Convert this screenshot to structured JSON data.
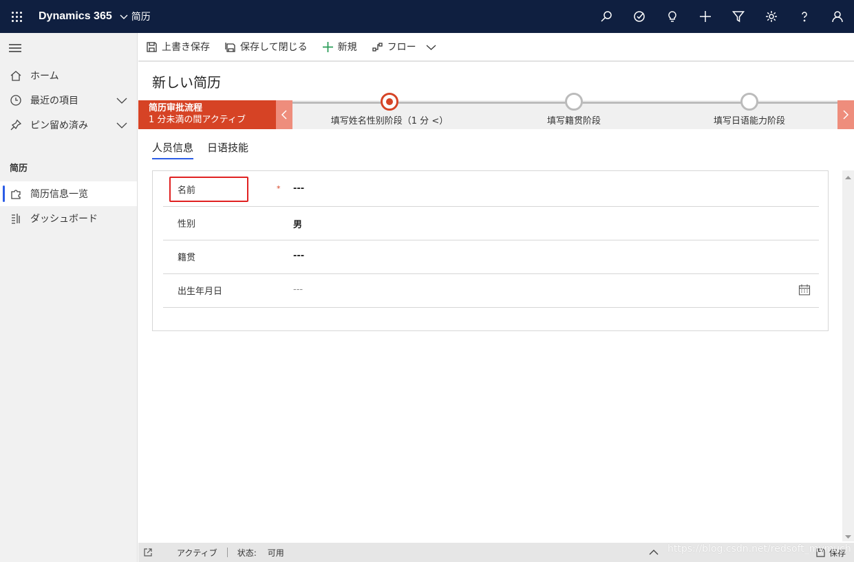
{
  "topbar": {
    "app_name": "Dynamics 365",
    "module_name": "简历",
    "icons": [
      "search-icon",
      "assistant-icon",
      "lightbulb-icon",
      "plus-icon",
      "filter-icon",
      "gear-icon",
      "help-icon",
      "user-icon"
    ]
  },
  "sidebar": {
    "items": [
      {
        "label": "ホーム",
        "icon": "home-icon"
      },
      {
        "label": "最近の項目",
        "icon": "clock-icon"
      },
      {
        "label": "ピン留め済み",
        "icon": "pin-icon"
      }
    ],
    "group_title": "简历",
    "group_items": [
      {
        "label": "简历信息一览",
        "icon": "puzzle-icon"
      },
      {
        "label": "ダッシュボード",
        "icon": "dashboard-icon"
      }
    ]
  },
  "commandbar": {
    "save": "上書き保存",
    "save_close": "保存して閉じる",
    "new": "新規",
    "flow": "フロー"
  },
  "form": {
    "title": "新しい简历"
  },
  "bpf": {
    "title": "简历审批流程",
    "subtitle": "1 分未満の間アクティブ",
    "stages": [
      {
        "label": "填写姓名性别阶段（1 分 <）",
        "active": true
      },
      {
        "label": "填写籍贯阶段",
        "active": false
      },
      {
        "label": "填写日语能力阶段",
        "active": false
      }
    ]
  },
  "tabs": [
    {
      "label": "人员信息",
      "active": true
    },
    {
      "label": "日语技能",
      "active": false
    }
  ],
  "fields": [
    {
      "label": "名前",
      "required": "*",
      "value": "---"
    },
    {
      "label": "性别",
      "required": "",
      "value": "男"
    },
    {
      "label": "籍贯",
      "required": "",
      "value": "---"
    },
    {
      "label": "出生年月日",
      "required": "",
      "value": "---"
    }
  ],
  "footer": {
    "status": "アクティブ",
    "state_label": "状态:",
    "state_value": "可用",
    "save": "保存"
  },
  "watermark": "https://blog.csdn.net/redsoft_mymuch",
  "colors": {
    "topbar": "#0f1f40",
    "bpf_active": "#d64325",
    "accent": "#2b5ce6",
    "highlight": "#e02020"
  }
}
